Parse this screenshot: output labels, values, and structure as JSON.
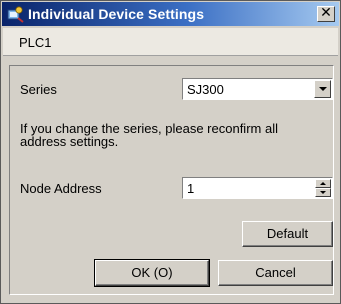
{
  "window": {
    "title": "Individual Device Settings",
    "close_glyph": "✕"
  },
  "device": {
    "name": "PLC1"
  },
  "series": {
    "label": "Series",
    "value": "SJ300"
  },
  "message": "If you change the series, please reconfirm all address settings.",
  "node_address": {
    "label": "Node Address",
    "value": "1"
  },
  "buttons": {
    "default": "Default",
    "ok": "OK (O)",
    "cancel": "Cancel"
  },
  "icons": {
    "title": "device-settings-icon",
    "close": "close-icon",
    "combo": "chevron-down-icon",
    "spin_up": "spin-up-icon",
    "spin_down": "spin-down-icon"
  }
}
